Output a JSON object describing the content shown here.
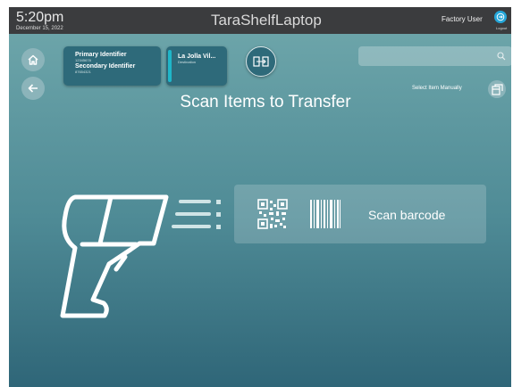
{
  "header": {
    "time": "5:20pm",
    "date": "December 15, 2022",
    "app_title": "TaraShelfLaptop",
    "user_name": "Factory User",
    "logout_label": "Logout"
  },
  "item_card": {
    "primary_label": "Primary Identifier",
    "primary_value": "12345678",
    "secondary_label": "Secondary Identifier",
    "secondary_value": "87654321"
  },
  "destination_card": {
    "name": "La Jolla Vil...",
    "label": "Destination"
  },
  "search": {
    "placeholder": ""
  },
  "select_manual_label": "Select Item Manually",
  "heading": "Scan Items to Transfer",
  "scan_panel": {
    "label": "Scan barcode"
  },
  "icons": {
    "home": "home-icon",
    "back": "arrow-left-icon",
    "transfer": "transfer-icon",
    "search": "search-icon",
    "manual": "manual-select-icon",
    "logout": "logout-icon",
    "scanner": "barcode-scanner-icon",
    "qr": "qr-code-icon",
    "barcode": "barcode-icon"
  },
  "colors": {
    "topbar": "#3b3c3e",
    "accent": "#24a6d9",
    "card": "#2e6a7a",
    "card_selected_stripe": "#1fb6c9"
  }
}
